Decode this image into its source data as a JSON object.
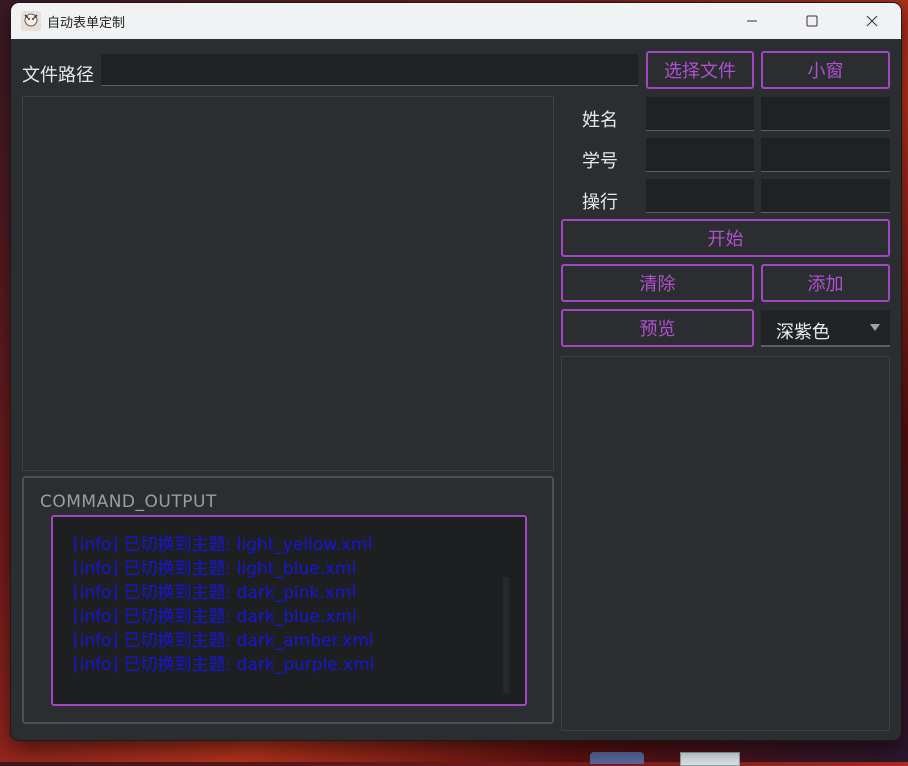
{
  "window": {
    "title": "自动表单定制"
  },
  "file": {
    "label": "文件路径",
    "value": "",
    "select_button": "选择文件",
    "mini_button": "小窗"
  },
  "form": {
    "name_label": "姓名",
    "id_label": "学号",
    "conduct_label": "操行"
  },
  "actions": {
    "start": "开始",
    "clear": "清除",
    "add": "添加",
    "preview": "预览"
  },
  "theme_select": {
    "value": "深紫色"
  },
  "console": {
    "title": "COMMAND_OUTPUT",
    "lines": [
      "[info] 已切换到主题: light_yellow.xml",
      "[info] 已切换到主题: light_blue.xml",
      "[info] 已切换到主题: dark_pink.xml",
      "[info] 已切换到主题: dark_blue.xml",
      "[info] 已切换到主题: dark_amber.xml",
      "[info] 已切换到主题: dark_purple.xml"
    ]
  },
  "colors": {
    "accent": "#a445c4",
    "accent_text": "#b14fd1",
    "console_text": "#1616d8",
    "window_bg": "#2b2e31"
  }
}
